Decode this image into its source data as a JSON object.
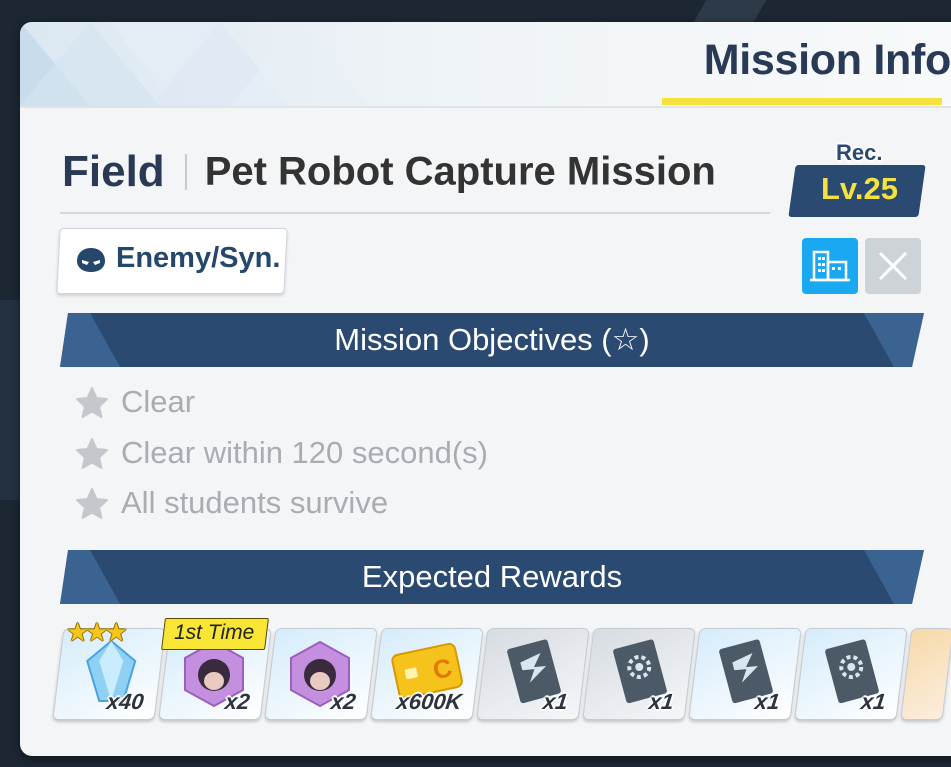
{
  "window": {
    "title": "Mission Info"
  },
  "stage": {
    "area": "Field",
    "name": "Pet Robot Capture Mission",
    "rec_label": "Rec.",
    "rec_level": "Lv.25"
  },
  "enemy_tag": {
    "label": "Enemy/Syn.",
    "icon": "enemy-mask-icon"
  },
  "terrain_button": {
    "icon": "urban-terrain-icon"
  },
  "close_button": {
    "icon": "close-icon"
  },
  "objectives": {
    "title": "Mission Objectives (☆)",
    "items": [
      {
        "label": "Clear",
        "icon": "star-icon"
      },
      {
        "label": "Clear within 120 second(s)",
        "icon": "star-icon"
      },
      {
        "label": "All students survive",
        "icon": "star-icon"
      }
    ]
  },
  "rewards": {
    "title": "Expected Rewards",
    "first_time_label": "1st Time",
    "stars": "★★★",
    "items": [
      {
        "name": "pyroxene-crystal-icon",
        "qty": "x40"
      },
      {
        "name": "student-eleph-purple-icon",
        "qty": "x2"
      },
      {
        "name": "student-eleph-purple-icon",
        "qty": "x2"
      },
      {
        "name": "credits-card-icon",
        "qty": "x600K"
      },
      {
        "name": "tech-notes-book-icon",
        "qty": "x1"
      },
      {
        "name": "tech-notes-book-gear-icon",
        "qty": "x1"
      },
      {
        "name": "tech-notes-book-icon",
        "qty": "x1"
      },
      {
        "name": "tech-notes-book-gear-icon",
        "qty": "x1"
      }
    ]
  },
  "colors": {
    "navy": "#2b4a72",
    "accent_yellow": "#f5e23c",
    "terrain_blue": "#1aa8f0",
    "objective_gray": "#a8adb3"
  }
}
